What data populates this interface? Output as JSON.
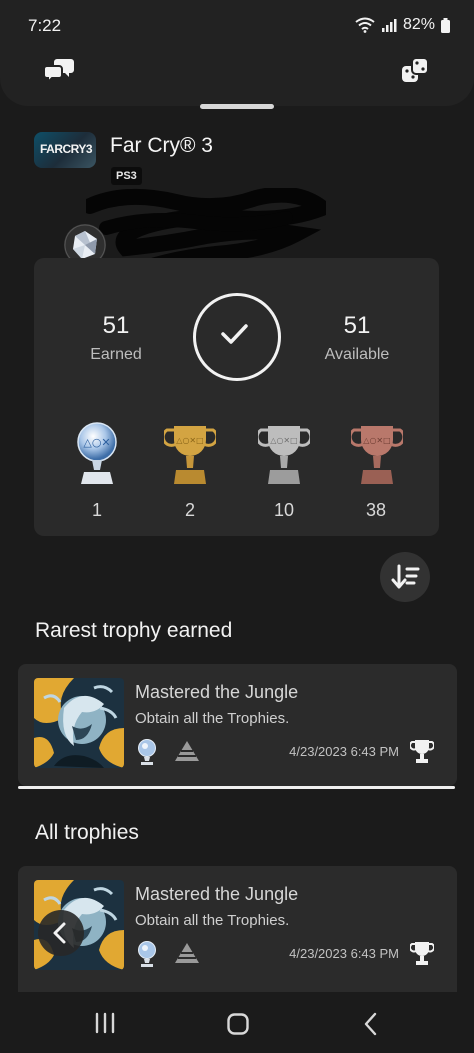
{
  "status_bar": {
    "time": "7:22",
    "battery": "82%",
    "icons": [
      "wifi-icon",
      "signal-icon",
      "battery-icon"
    ]
  },
  "header": {
    "left_icon": "chat-icon",
    "right_icon": "game-controller-icon"
  },
  "game": {
    "thumbnail_text": "FARCRY3",
    "title": "Far Cry® 3",
    "platform": "PS3"
  },
  "summary": {
    "earned_value": "51",
    "earned_label": "Earned",
    "available_value": "51",
    "available_label": "Available",
    "trophies": [
      {
        "type": "platinum",
        "count": "1",
        "color": "#b9d3ef"
      },
      {
        "type": "gold",
        "count": "2",
        "color": "#d3a442"
      },
      {
        "type": "silver",
        "count": "10",
        "color": "#bdbdbd"
      },
      {
        "type": "bronze",
        "count": "38",
        "color": "#b9786b"
      }
    ]
  },
  "sort_icon": "sort-icon",
  "rarest": {
    "section_title": "Rarest trophy earned",
    "card": {
      "name": "Mastered the Jungle",
      "description": "Obtain all the Trophies.",
      "date": "4/23/2023  6:43 PM"
    }
  },
  "all": {
    "section_title": "All trophies",
    "card": {
      "name": "Mastered the Jungle",
      "description": "Obtain all the Trophies.",
      "date": "4/23/2023  6:43 PM"
    }
  },
  "nav": {
    "icons": [
      "recent-apps-icon",
      "home-icon",
      "back-icon"
    ]
  }
}
